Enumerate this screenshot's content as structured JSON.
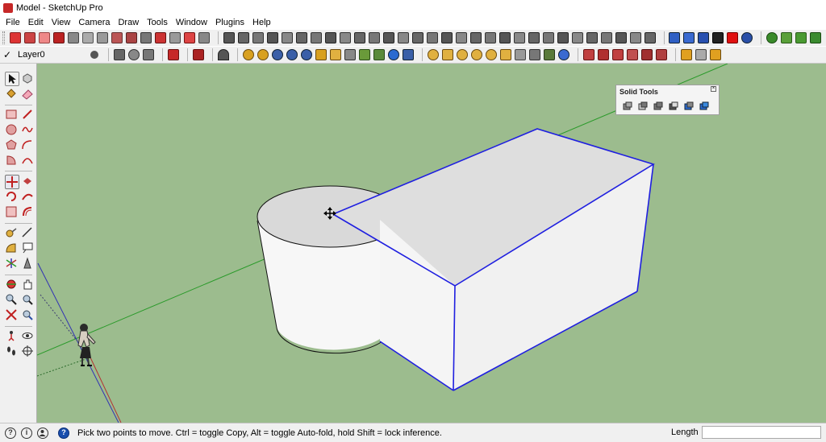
{
  "window": {
    "title": "Model - SketchUp Pro"
  },
  "menu": [
    "File",
    "Edit",
    "View",
    "Camera",
    "Draw",
    "Tools",
    "Window",
    "Plugins",
    "Help"
  ],
  "layer": {
    "current": "Layer0"
  },
  "solid_tools": {
    "title": "Solid Tools",
    "close_glyph": "×"
  },
  "status": {
    "message": "Pick two points to move.  Ctrl = toggle Copy, Alt = toggle Auto-fold, hold Shift = lock inference.",
    "measure_label": "Length",
    "measure_value": "",
    "help_glyph": "?",
    "geo_glyph": "?",
    "credits_glyph": "i"
  },
  "colors": {
    "viewport": "#9cbc8e",
    "selection_edge": "#1f1fe0",
    "green_axis": "#2a9a2a",
    "red_axis": "#b43232",
    "blue_axis": "#3232b4"
  }
}
